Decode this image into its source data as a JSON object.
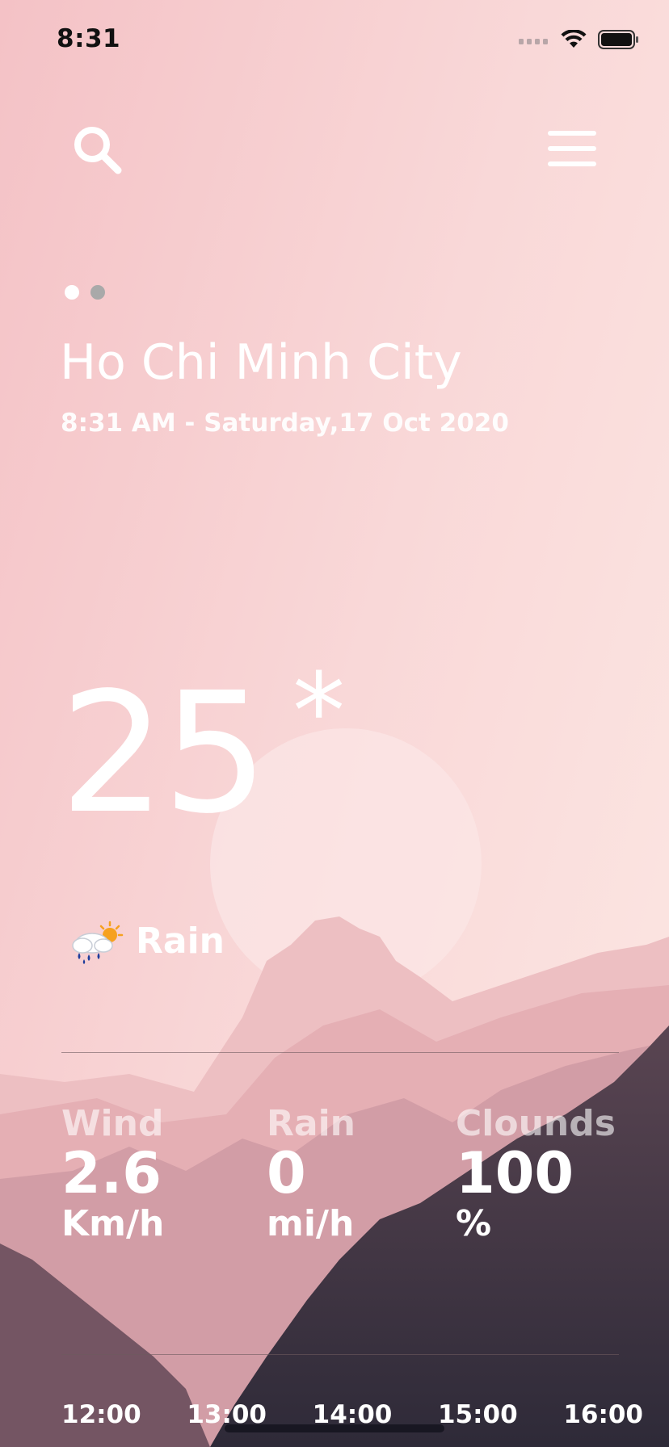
{
  "status_bar": {
    "time": "8:31"
  },
  "header": {
    "search_icon": "search-icon",
    "menu_icon": "menu-icon"
  },
  "pager": {
    "active_index": 0,
    "count": 2
  },
  "location": {
    "city": "Ho Chi Minh City",
    "datetime": "8:31 AM - Saturday,17 Oct 2020"
  },
  "current": {
    "temperature": "25",
    "unit": "*",
    "condition": "Rain",
    "condition_icon": "rain-sun-icon"
  },
  "stats": {
    "wind": {
      "label": "Wind",
      "value": "2.6",
      "unit": "Km/h"
    },
    "rain": {
      "label": "Rain",
      "value": "0",
      "unit": "mi/h"
    },
    "clouds": {
      "label": "Clounds",
      "value": "100",
      "unit": "%"
    }
  },
  "hourly": [
    "12:00",
    "13:00",
    "14:00",
    "15:00",
    "16:00"
  ],
  "colors": {
    "sky_top": "#f6c9cc",
    "sky_bottom": "#fbe1df",
    "mountain_dark": "#3d3644"
  }
}
